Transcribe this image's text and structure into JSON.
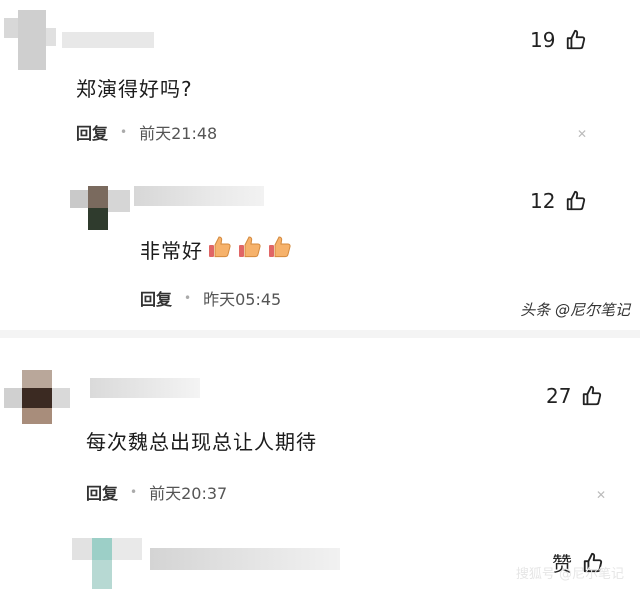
{
  "comments": [
    {
      "text": "郑演得好吗?",
      "likes": "19",
      "reply_label": "回复",
      "time": "前天21:48"
    },
    {
      "text": "非常好",
      "likes": "12",
      "reply_label": "回复",
      "time": "昨天05:45",
      "emoji": [
        "thumbs-up",
        "thumbs-up",
        "thumbs-up"
      ]
    },
    {
      "text": "每次魏总出现总让人期待",
      "likes": "27",
      "reply_label": "回复",
      "time": "前天20:37"
    },
    {
      "text": "",
      "like_label": "赞"
    }
  ],
  "watermark": "头条 @尼尔笔记",
  "bottom_watermark": "搜狐号 @尼尔笔记",
  "icons": {
    "like": "thumbs-up-outline-icon",
    "close": "close-x-icon",
    "emoji": "thumbs-up-emoji-icon"
  },
  "colors": {
    "background": "#ffffff",
    "separator": "#f4f4f4",
    "text": "#1b1b1b",
    "meta": "#555555",
    "emoji_fill": "#f6b26b",
    "emoji_cuff": "#e06666"
  }
}
